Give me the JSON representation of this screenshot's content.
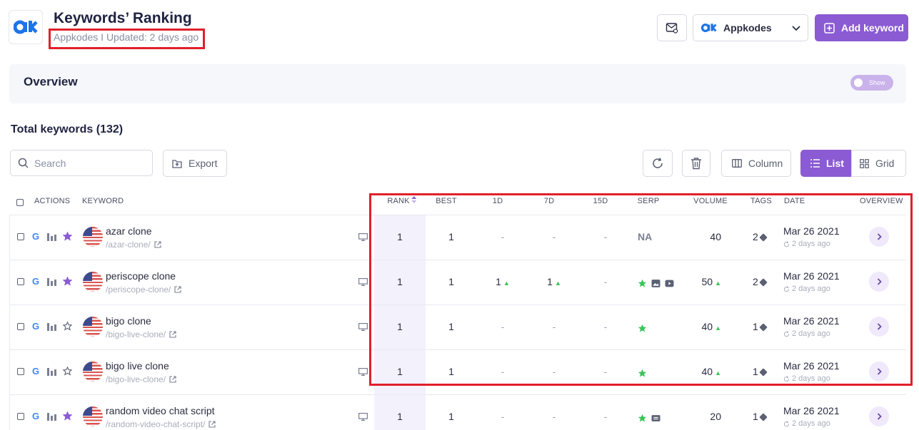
{
  "header": {
    "title": "Keywords’ Ranking",
    "subtitle": "Appkodes I Updated: 2 days ago",
    "logo_text": "ak",
    "project_select": "Appkodes",
    "add_button": "Add keyword"
  },
  "overview": {
    "title": "Overview",
    "toggle_label": "Show"
  },
  "total_label": "Total keywords (132)",
  "toolbar": {
    "search_placeholder": "Search",
    "export_label": "Export",
    "column_label": "Column",
    "list_label": "List",
    "grid_label": "Grid"
  },
  "table": {
    "headers": {
      "actions": "ACTIONS",
      "keyword": "KEYWORD",
      "rank": "RANK",
      "best": "BEST",
      "d1": "1D",
      "d7": "7D",
      "d15": "15D",
      "serp": "SERP",
      "volume": "VOLUME",
      "tags": "TAGS",
      "date": "DATE",
      "overview": "OVERVIEW"
    },
    "rows": [
      {
        "keyword": "azar clone",
        "url": "/azar-clone/",
        "starred": true,
        "rank": "1",
        "best": "1",
        "d1": "-",
        "d1_up": false,
        "d7": "-",
        "d7_up": false,
        "d15": "-",
        "serp": "NA",
        "serp_icons": [],
        "volume": "40",
        "volume_up": false,
        "tags": "2",
        "date": "Mar 26 2021",
        "ago": "2 days ago"
      },
      {
        "keyword": "periscope clone",
        "url": "/periscope-clone/",
        "starred": true,
        "rank": "1",
        "best": "1",
        "d1": "1",
        "d1_up": true,
        "d7": "1",
        "d7_up": true,
        "d15": "-",
        "serp": "",
        "serp_icons": [
          "star-icon",
          "image-icon",
          "video-icon"
        ],
        "volume": "50",
        "volume_up": true,
        "tags": "2",
        "date": "Mar 26 2021",
        "ago": "2 days ago"
      },
      {
        "keyword": "bigo clone",
        "url": "/bigo-live-clone/",
        "starred": false,
        "rank": "1",
        "best": "1",
        "d1": "-",
        "d1_up": false,
        "d7": "-",
        "d7_up": false,
        "d15": "-",
        "serp": "",
        "serp_icons": [
          "star-icon"
        ],
        "volume": "40",
        "volume_up": true,
        "tags": "1",
        "date": "Mar 26 2021",
        "ago": "2 days ago"
      },
      {
        "keyword": "bigo live clone",
        "url": "/bigo-live-clone/",
        "starred": false,
        "rank": "1",
        "best": "1",
        "d1": "-",
        "d1_up": false,
        "d7": "-",
        "d7_up": false,
        "d15": "-",
        "serp": "",
        "serp_icons": [
          "star-icon"
        ],
        "volume": "40",
        "volume_up": true,
        "tags": "1",
        "date": "Mar 26 2021",
        "ago": "2 days ago"
      },
      {
        "keyword": "random video chat script",
        "url": "/random-video-chat-script/",
        "starred": true,
        "rank": "1",
        "best": "1",
        "d1": "-",
        "d1_up": false,
        "d7": "-",
        "d7_up": false,
        "d15": "-",
        "serp": "",
        "serp_icons": [
          "star-icon",
          "ad-icon"
        ],
        "volume": "20",
        "volume_up": false,
        "tags": "1",
        "date": "Mar 26 2021",
        "ago": "2 days ago"
      }
    ]
  },
  "colors": {
    "accent": "#8b5bd3",
    "highlight": "#e0202a",
    "up": "#3cc35a",
    "rank_bg": "#f3f1fb"
  }
}
